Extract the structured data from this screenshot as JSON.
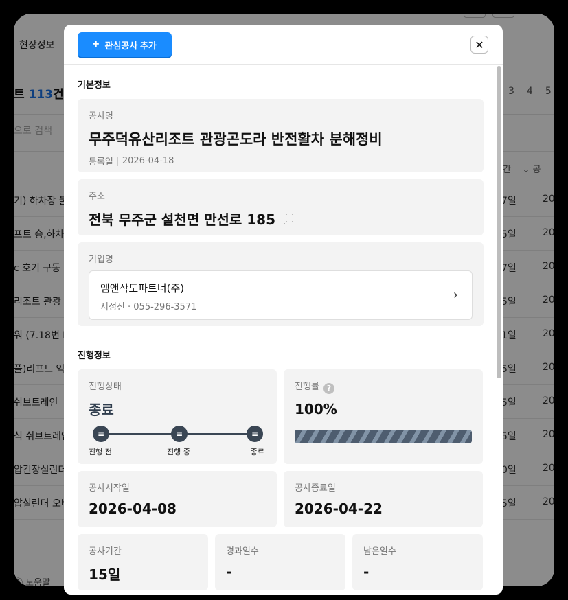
{
  "background": {
    "nav_item": "현장정보",
    "count_prefix": "트 ",
    "count_number": "113",
    "count_suffix": "건",
    "search_placeholder": "으로 검색",
    "pages": [
      "3",
      "4",
      "5"
    ],
    "col_header_1": "간",
    "col_header_2": "공",
    "rows": [
      {
        "title": "기) 하차장 불",
        "days": "7일",
        "year": "20"
      },
      {
        "title": "프트 승,하차장",
        "days": "5일",
        "year": "20"
      },
      {
        "title": "c 호기 구동",
        "days": "7일",
        "year": "20"
      },
      {
        "title": "리조트 관광",
        "days": "5일",
        "year": "20"
      },
      {
        "title": "워 (7.18번 E",
        "days": "1일",
        "year": "20"
      },
      {
        "title": "플)리프트 익",
        "days": "5일",
        "year": "20"
      },
      {
        "title": "쉬브트레인",
        "days": "5일",
        "year": "20"
      },
      {
        "title": "식 쉬브트레인",
        "days": "5일",
        "year": "20"
      },
      {
        "title": "압긴장실린더",
        "days": "0일",
        "year": "20"
      },
      {
        "title": "압실린더 오버",
        "days": "5일",
        "year": "20"
      }
    ],
    "help_label": "도움말"
  },
  "modal": {
    "add_button_label": "관심공사 추가",
    "basic_section_title": "기본정보",
    "project": {
      "label": "공사명",
      "name": "무주덕유산리조트 관광곤도라 반전활차 분해정비",
      "registered_label": "등록일",
      "registered_date": "2026-04-18"
    },
    "address": {
      "label": "주소",
      "value": "전북 무주군 설천면 만선로 185"
    },
    "company": {
      "label": "기업명",
      "name": "엠앤삭도파트너(주)",
      "contact": "서정진 · 055-296-3571"
    },
    "progress_section_title": "진행정보",
    "status": {
      "label": "진행상태",
      "value": "종료",
      "steps": [
        "진행 전",
        "진행 중",
        "종료"
      ]
    },
    "rate": {
      "label": "진행률",
      "value": "100%",
      "fraction": 1.0
    },
    "start": {
      "label": "공사시작일",
      "value": "2026-04-08"
    },
    "end": {
      "label": "공사종료일",
      "value": "2026-04-22"
    },
    "duration": {
      "label": "공사기간",
      "value": "15일"
    },
    "elapsed": {
      "label": "경과일수",
      "value": "-"
    },
    "remaining": {
      "label": "남은일수",
      "value": "-"
    }
  },
  "colors": {
    "primary_button": "#1a8cff",
    "status_dark": "#3a4654",
    "card_bg": "#f3f3f3"
  }
}
